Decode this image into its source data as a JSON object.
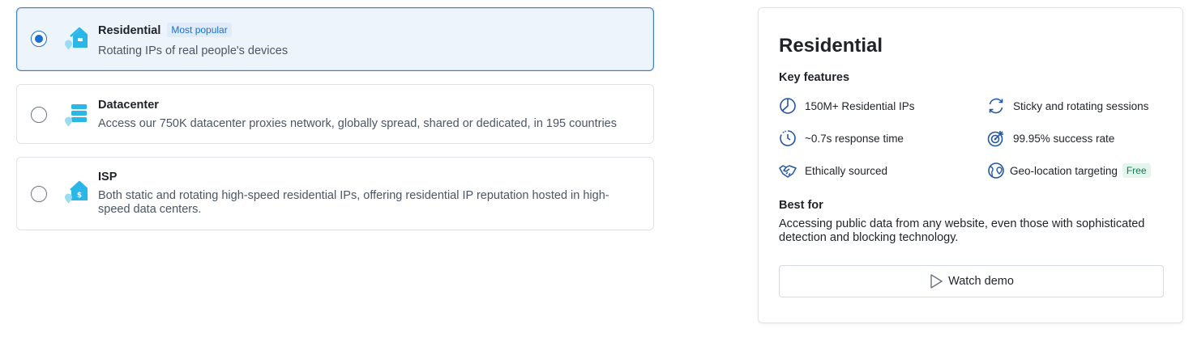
{
  "options": [
    {
      "title": "Residential",
      "badge": "Most popular",
      "description": "Rotating IPs of real people's devices",
      "selected": true,
      "icon": "residential-house-icon"
    },
    {
      "title": "Datacenter",
      "description": "Access our 750K datacenter proxies network, globally spread, shared or dedicated, in 195 countries",
      "selected": false,
      "icon": "datacenter-server-icon"
    },
    {
      "title": "ISP",
      "description": "Both static and rotating high-speed residential IPs, offering residential IP reputation hosted in high-speed data centers.",
      "selected": false,
      "icon": "isp-house-icon"
    }
  ],
  "panel": {
    "title": "Residential",
    "key_features_label": "Key features",
    "features": [
      {
        "label": "150M+ Residential IPs",
        "icon": "pie-chart-icon"
      },
      {
        "label": "Sticky and rotating sessions",
        "icon": "rotate-arrows-icon"
      },
      {
        "label": "~0.7s response time",
        "icon": "timer-icon"
      },
      {
        "label": "99.95% success rate",
        "icon": "target-icon"
      },
      {
        "label": "Ethically sourced",
        "icon": "handshake-icon"
      },
      {
        "label": "Geo-location targeting",
        "icon": "globe-pin-icon",
        "badge": "Free"
      }
    ],
    "best_for_label": "Best for",
    "best_for_text": "Accessing public data from any website, even those with sophisticated detection and blocking technology.",
    "demo_button": "Watch demo"
  },
  "colors": {
    "accent": "#1a6fd1",
    "icon_cyan": "#2bb6e8",
    "icon_blue": "#2456a6",
    "selected_bg": "#eef4fb",
    "free_badge": "#0f7a55"
  }
}
